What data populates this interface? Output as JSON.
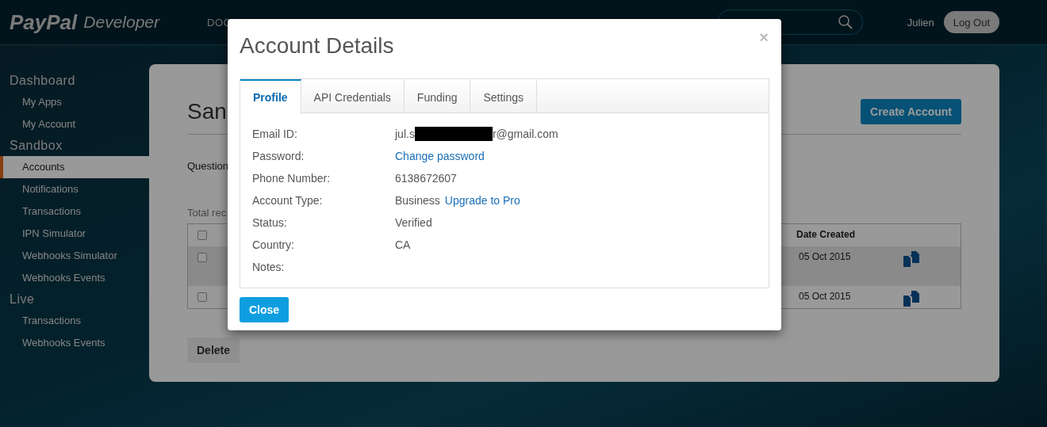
{
  "header": {
    "brand": "PayPal",
    "brand_suffix": "Developer",
    "nav": [
      "DOC"
    ],
    "user": "Julien",
    "logout": "Log Out"
  },
  "sidebar": [
    {
      "heading": "Dashboard",
      "items": [
        {
          "label": "My Apps",
          "selected": false
        },
        {
          "label": "My Account",
          "selected": false
        }
      ]
    },
    {
      "heading": "Sandbox",
      "items": [
        {
          "label": "Accounts",
          "selected": true
        },
        {
          "label": "Notifications",
          "selected": false
        },
        {
          "label": "Transactions",
          "selected": false
        },
        {
          "label": "IPN Simulator",
          "selected": false
        },
        {
          "label": "Webhooks Simulator",
          "selected": false
        },
        {
          "label": "Webhooks Events",
          "selected": false
        }
      ]
    },
    {
      "heading": "Live",
      "items": [
        {
          "label": "Transactions",
          "selected": false
        },
        {
          "label": "Webhooks Events",
          "selected": false
        }
      ]
    }
  ],
  "content": {
    "title": "San",
    "create_button": "Create Account",
    "question": "Question",
    "total": "Total rec",
    "table": {
      "header_checked": false,
      "date_column": "Date Created",
      "rows": [
        {
          "checked": false,
          "date": "05 Oct 2015",
          "highlighted": true
        },
        {
          "checked": false,
          "date": "05 Oct 2015",
          "highlighted": false
        }
      ]
    },
    "delete_button": "Delete"
  },
  "modal": {
    "title": "Account Details",
    "close_glyph": "×",
    "tabs": [
      {
        "label": "Profile",
        "selected": true
      },
      {
        "label": "API Credentials",
        "selected": false
      },
      {
        "label": "Funding",
        "selected": false
      },
      {
        "label": "Settings",
        "selected": false
      }
    ],
    "fields": [
      {
        "kind": "redacted",
        "label": "Email ID:",
        "value": "jul.s",
        "value_end": "r@gmail.com"
      },
      {
        "kind": "link",
        "label": "Password:",
        "link": "Change password"
      },
      {
        "kind": "text",
        "label": "Phone Number:",
        "value": "6138672607"
      },
      {
        "kind": "text_link",
        "label": "Account Type:",
        "value": "Business",
        "link": "Upgrade to Pro"
      },
      {
        "kind": "text",
        "label": "Status:",
        "value": "Verified"
      },
      {
        "kind": "text",
        "label": "Country:",
        "value": "CA"
      },
      {
        "kind": "text",
        "label": "Notes:"
      }
    ],
    "close_button": "Close"
  }
}
